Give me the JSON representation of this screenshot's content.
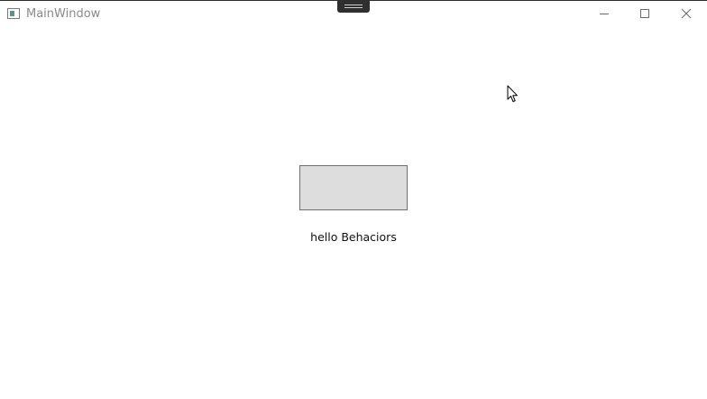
{
  "window": {
    "title": "MainWindow",
    "icon": "app-window-icon"
  },
  "caption_buttons": {
    "minimize_icon": "minimize-icon",
    "maximize_icon": "maximize-icon",
    "close_icon": "close-icon"
  },
  "main": {
    "button_label": "",
    "label_text": "hello Behaciors"
  },
  "colors": {
    "button_fill": "#dddddd",
    "button_border": "#707070",
    "title_text": "#8a8a8a",
    "background": "#ffffff"
  }
}
